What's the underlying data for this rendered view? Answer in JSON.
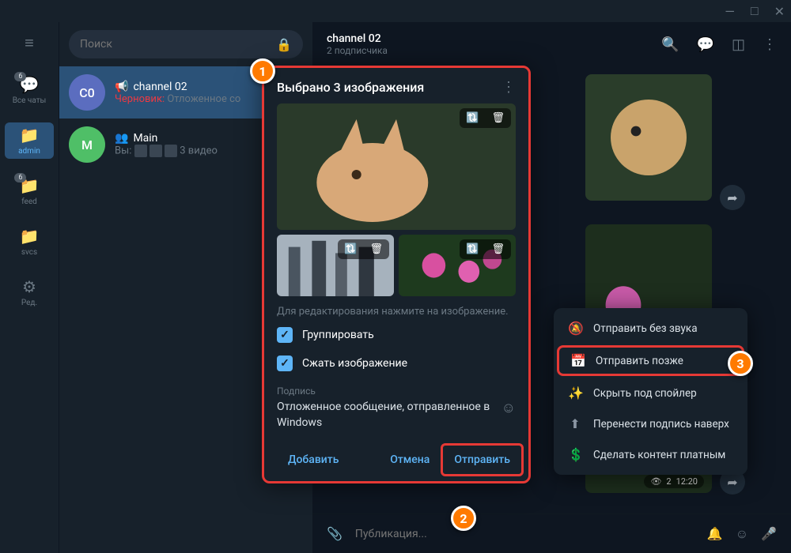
{
  "titlebar": {
    "min": "—",
    "max": "□",
    "close": "✕"
  },
  "filters": {
    "all": {
      "label": "Все чаты",
      "badge": "6"
    },
    "admin": {
      "label": "admin"
    },
    "feed": {
      "label": "feed",
      "badge": "6"
    },
    "svcs": {
      "label": "svcs"
    },
    "edit": {
      "label": "Ред."
    }
  },
  "search": {
    "placeholder": "Поиск"
  },
  "chats": {
    "c1": {
      "avatar": "C0",
      "title": "channel 02",
      "draft_label": "Черновик:",
      "draft_text": " Отложенное со"
    },
    "c2": {
      "avatar": "M",
      "title": "Main",
      "you": "Вы:",
      "tail": " 3 видео"
    }
  },
  "header": {
    "title": "channel 02",
    "sub": "2 подписчика"
  },
  "modal": {
    "title": "Выбрано 3 изображения",
    "hint": "Для редактирования нажмите на изображение.",
    "group": "Группировать",
    "compress": "Сжать изображение",
    "caption_label": "Подпись",
    "caption_text": "Отложенное сообщение, отправленное в Windows",
    "add": "Добавить",
    "cancel": "Отмена",
    "send": "Отправить"
  },
  "ctx": {
    "mute": "Отправить без звука",
    "later": "Отправить позже",
    "spoiler": "Скрыть под спойлер",
    "caption_up": "Перенести подпись наверх",
    "paid": "Сделать контент платным"
  },
  "composer": {
    "placeholder": "Публикация..."
  },
  "msgmeta": {
    "views": "2",
    "time": "12:20"
  },
  "callouts": {
    "one": "1",
    "two": "2",
    "three": "3"
  }
}
